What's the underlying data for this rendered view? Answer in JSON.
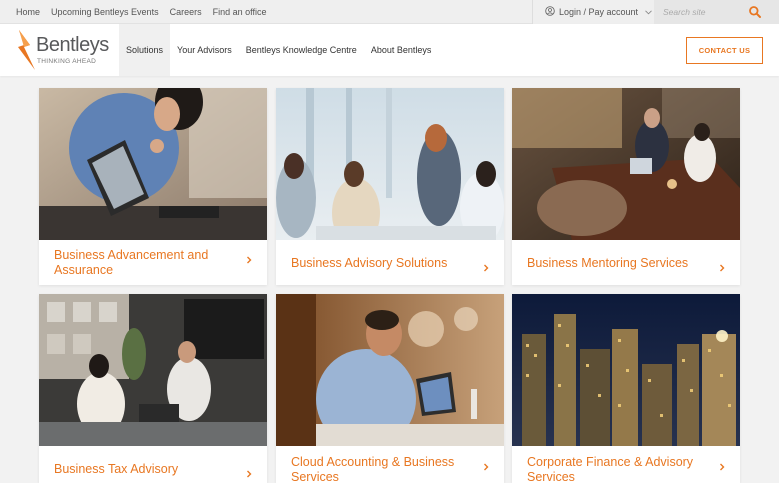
{
  "topbar": {
    "links": [
      "Home",
      "Upcoming Bentleys Events",
      "Careers",
      "Find an office"
    ],
    "login_label": "Login / Pay account",
    "search_placeholder": "Search site"
  },
  "header": {
    "logo_word": "Bentleys",
    "logo_tagline": "THINKING AHEAD",
    "nav": [
      "Solutions",
      "Your Advisors",
      "Bentleys Knowledge Centre",
      "About Bentleys"
    ],
    "contact_label": "CONTACT US"
  },
  "cards": [
    {
      "title": "Business Advancement and Assurance"
    },
    {
      "title": "Business Advisory Solutions"
    },
    {
      "title": "Business Mentoring Services"
    },
    {
      "title": "Business Tax Advisory"
    },
    {
      "title": "Cloud Accounting & Business Services"
    },
    {
      "title": "Corporate Finance & Advisory Services"
    }
  ],
  "colors": {
    "accent": "#e87722",
    "topbar_bg": "#efefef",
    "page_bg": "#f2f2f2"
  },
  "icons": {
    "user": "user-circle-icon",
    "chevron": "chevron-down-icon",
    "search": "search-icon",
    "arrow": "chevron-right-icon"
  }
}
